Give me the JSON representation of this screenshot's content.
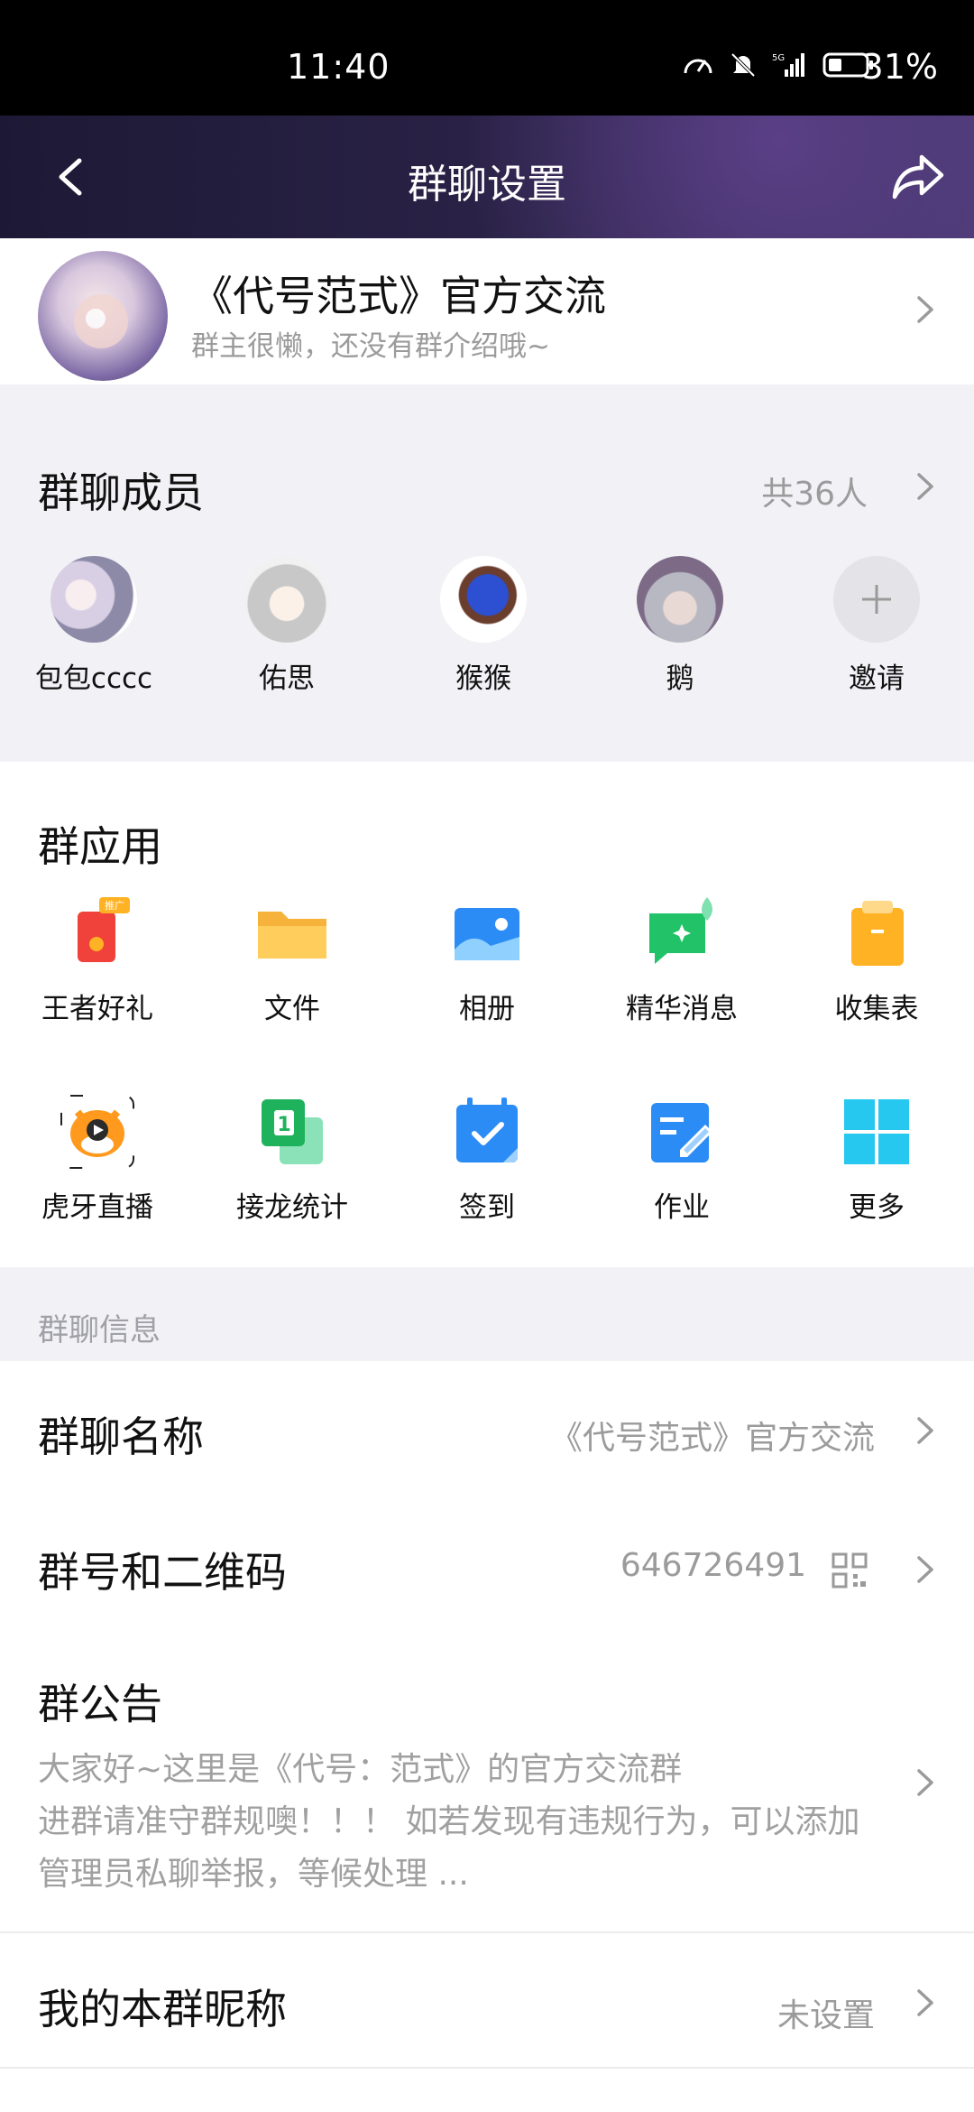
{
  "status_bar": {
    "time": "11:40",
    "battery": "31%"
  },
  "nav": {
    "title": "群聊设置"
  },
  "group": {
    "name": "《代号范式》官方交流",
    "description": "群主很懒，还没有群介绍哦~"
  },
  "members": {
    "label": "群聊成员",
    "count": "共36人",
    "items": [
      {
        "name": "包包cccc"
      },
      {
        "name": "佑思"
      },
      {
        "name": "猴猴"
      },
      {
        "name": "鹅"
      },
      {
        "name": "邀请"
      }
    ]
  },
  "apps": {
    "label": "群应用",
    "items": [
      {
        "label": "王者好礼",
        "icon": "gift-icon",
        "badge": "推广"
      },
      {
        "label": "文件",
        "icon": "folder-icon"
      },
      {
        "label": "相册",
        "icon": "album-icon"
      },
      {
        "label": "精华消息",
        "icon": "essence-message-icon"
      },
      {
        "label": "收集表",
        "icon": "clipboard-icon"
      },
      {
        "label": "虎牙直播",
        "icon": "huya-live-icon"
      },
      {
        "label": "接龙统计",
        "icon": "solitaire-icon"
      },
      {
        "label": "签到",
        "icon": "checkin-calendar-icon"
      },
      {
        "label": "作业",
        "icon": "homework-icon"
      },
      {
        "label": "更多",
        "icon": "more-grid-icon"
      }
    ]
  },
  "info": {
    "section_label": "群聊信息",
    "group_name_label": "群聊名称",
    "group_name_value": "《代号范式》官方交流",
    "group_number_label": "群号和二维码",
    "group_number_value": "646726491",
    "notice_label": "群公告",
    "notice_lines": [
      "大家好~这里是《代号：范式》的官方交流群",
      "进群请准守群规噢！！！ 如若发现有违规行为，可以添加",
      "管理员私聊举报，等候处理 ..."
    ],
    "nickname_label": "我的本群昵称",
    "nickname_value": "未设置"
  },
  "colors": {
    "accent_blue": "#2b8cf6",
    "green": "#23c66b",
    "orange": "#ffb224"
  }
}
